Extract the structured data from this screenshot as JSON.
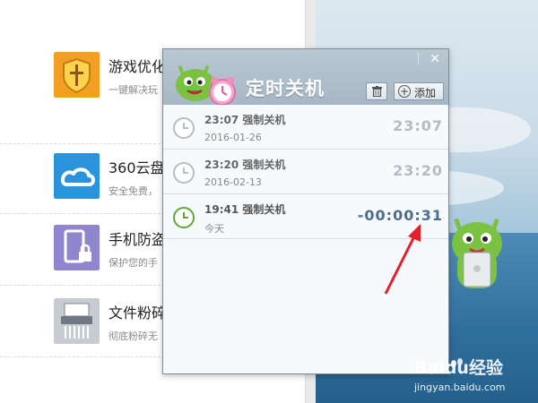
{
  "background_panel": {
    "tools": [
      {
        "name": "游戏优化",
        "desc": "一键解决玩",
        "icon": "shield-sword-icon",
        "color": "#f2a023"
      },
      {
        "name": "360云盘",
        "desc": "安全免费，",
        "icon": "cloud-icon",
        "color": "#2a93dc"
      },
      {
        "name": "手机防盗",
        "desc": "保护您的手",
        "icon": "phone-lock-icon",
        "color": "#8f86cf"
      },
      {
        "name": "文件粉碎",
        "desc": "彻底粉碎无",
        "icon": "shredder-icon",
        "color": "#c7ccd3"
      }
    ]
  },
  "dialog": {
    "title": "定时关机",
    "add_label": "添加",
    "close_glyph": "✕",
    "tasks": [
      {
        "title": "23:07 强制关机",
        "date": "2016-01-26",
        "time": "23:07",
        "active": false
      },
      {
        "title": "23:20 强制关机",
        "date": "2016-02-13",
        "time": "23:20",
        "active": false
      },
      {
        "title": "19:41 强制关机",
        "date": "今天",
        "time": "-00:00:31",
        "active": true
      }
    ]
  },
  "watermark": {
    "brand": "Baidu经验",
    "url": "jingyan.baidu.com"
  },
  "colors": {
    "active_clock": "#5aa93a",
    "inactive_clock": "#b6bec6",
    "arrow": "#e5202a",
    "countdown": "#4a6e8e"
  }
}
